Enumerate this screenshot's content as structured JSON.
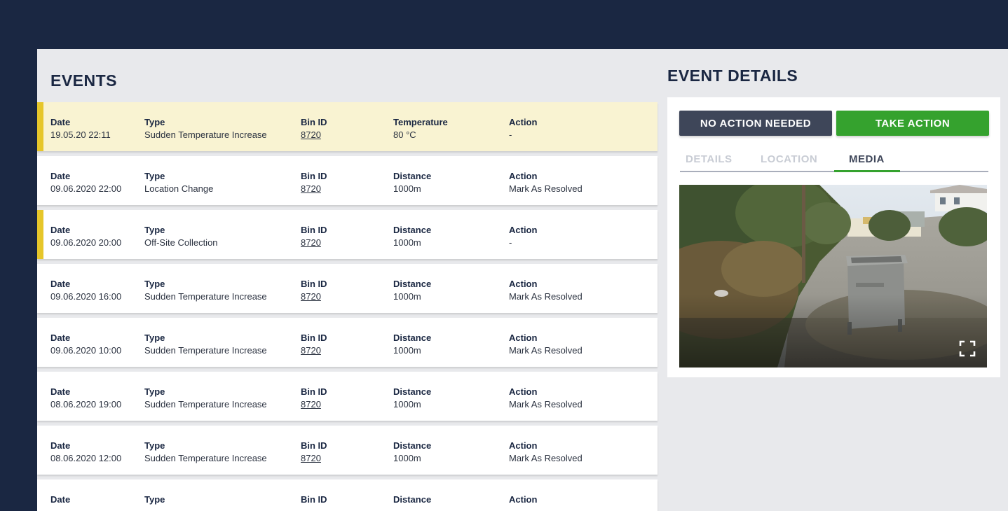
{
  "events": {
    "title": "EVENTS",
    "rows": [
      {
        "date_label": "Date",
        "date": "19.05.20  22:11",
        "type_label": "Type",
        "type": "Sudden Temperature Increase",
        "bin_label": "Bin ID",
        "bin": "8720",
        "metric_label": "Temperature",
        "metric": "80 °C",
        "action_label": "Action",
        "action": "-"
      },
      {
        "date_label": "Date",
        "date": "09.06.2020 22:00",
        "type_label": "Type",
        "type": "Location Change",
        "bin_label": "Bin ID",
        "bin": "8720",
        "metric_label": "Distance",
        "metric": "1000m",
        "action_label": "Action",
        "action": "Mark As Resolved"
      },
      {
        "date_label": "Date",
        "date": "09.06.2020 20:00",
        "type_label": "Type",
        "type": "Off-Site Collection",
        "bin_label": "Bin ID",
        "bin": "8720",
        "metric_label": "Distance",
        "metric": "1000m",
        "action_label": "Action",
        "action": "-"
      },
      {
        "date_label": "Date",
        "date": "09.06.2020 16:00",
        "type_label": "Type",
        "type": "Sudden Temperature Increase",
        "bin_label": "Bin ID",
        "bin": "8720",
        "metric_label": "Distance",
        "metric": "1000m",
        "action_label": "Action",
        "action": "Mark As Resolved"
      },
      {
        "date_label": "Date",
        "date": "09.06.2020 10:00",
        "type_label": "Type",
        "type": "Sudden Temperature Increase",
        "bin_label": "Bin ID",
        "bin": "8720",
        "metric_label": "Distance",
        "metric": "1000m",
        "action_label": "Action",
        "action": "Mark As Resolved"
      },
      {
        "date_label": "Date",
        "date": "08.06.2020 19:00",
        "type_label": "Type",
        "type": "Sudden Temperature Increase",
        "bin_label": "Bin ID",
        "bin": "8720",
        "metric_label": "Distance",
        "metric": "1000m",
        "action_label": "Action",
        "action": "Mark As Resolved"
      },
      {
        "date_label": "Date",
        "date": "08.06.2020 12:00",
        "type_label": "Type",
        "type": "Sudden Temperature Increase",
        "bin_label": "Bin ID",
        "bin": "8720",
        "metric_label": "Distance",
        "metric": "1000m",
        "action_label": "Action",
        "action": "Mark As Resolved"
      },
      {
        "date_label": "Date",
        "date": "",
        "type_label": "Type",
        "type": "",
        "bin_label": "Bin ID",
        "bin": "",
        "metric_label": "Distance",
        "metric": "",
        "action_label": "Action",
        "action": ""
      }
    ]
  },
  "details": {
    "title": "EVENT DETAILS",
    "no_action_label": "NO ACTION NEEDED",
    "take_action_label": "TAKE ACTION",
    "tabs": [
      "DETAILS",
      "LOCATION",
      "MEDIA"
    ],
    "active_tab": "MEDIA",
    "media_icon": "fullscreen-icon"
  },
  "colors": {
    "navy": "#1a2742",
    "highlight_row": "#f9f3d2",
    "flag_marker": "#e6c62a",
    "take_action": "#35a22e",
    "no_action": "#3e4659"
  }
}
